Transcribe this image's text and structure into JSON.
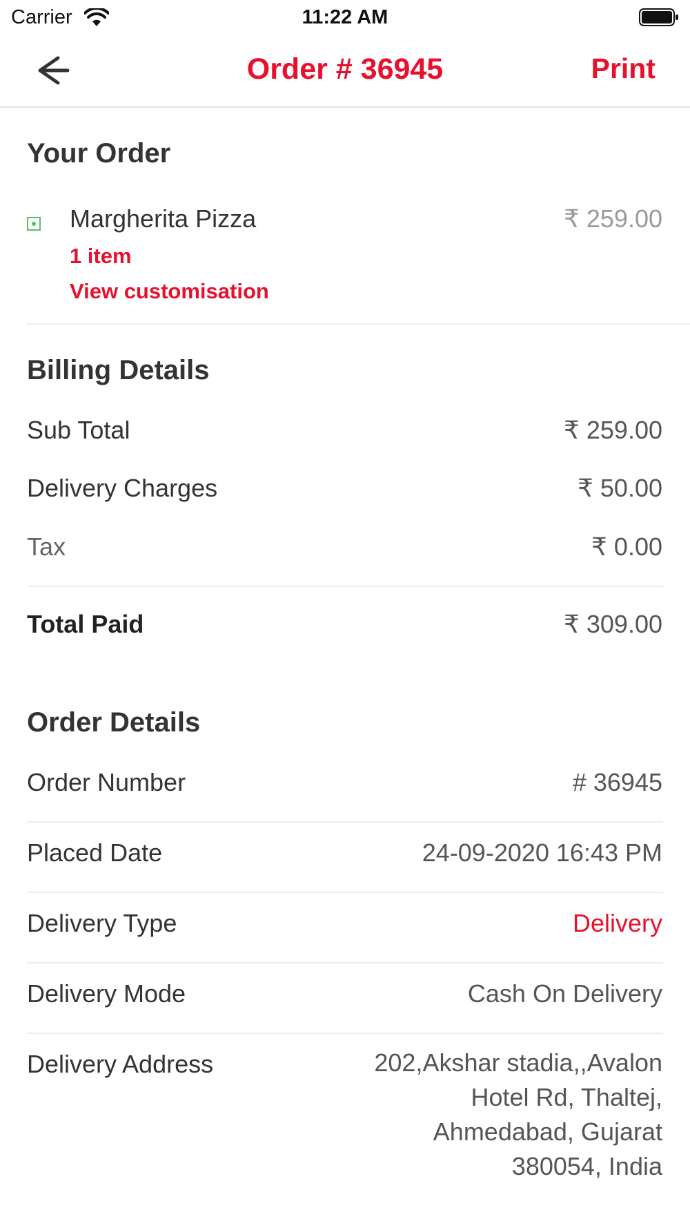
{
  "status_bar": {
    "carrier": "Carrier",
    "time": "11:22 AM"
  },
  "nav": {
    "title": "Order # 36945",
    "print_label": "Print",
    "accent_color": "#e8112d"
  },
  "your_order": {
    "title": "Your Order",
    "items": [
      {
        "name": "Margherita Pizza",
        "price": "₹ 259.00",
        "quantity": "1 item",
        "customisation_link": "View customisation",
        "veg_indicator_color": "#54c06c"
      }
    ]
  },
  "billing": {
    "title": "Billing Details",
    "rows": [
      {
        "label": "Sub Total",
        "value": "₹ 259.00"
      },
      {
        "label": "Delivery Charges",
        "value": "₹ 50.00"
      },
      {
        "label": "Tax",
        "value": "₹ 0.00"
      }
    ],
    "total": {
      "label": "Total Paid",
      "value": "₹ 309.00"
    }
  },
  "order_details": {
    "title": "Order Details",
    "rows": [
      {
        "label": "Order Number",
        "value": "# 36945"
      },
      {
        "label": "Placed Date",
        "value": "24-09-2020 16:43 PM"
      },
      {
        "label": "Delivery Type",
        "value": "Delivery"
      },
      {
        "label": "Delivery Mode",
        "value": "Cash On Delivery"
      }
    ],
    "address": {
      "label": "Delivery Address",
      "value": "202,Akshar stadia,,Avalon Hotel Rd, Thaltej, Ahmedabad, Gujarat 380054, India"
    }
  }
}
